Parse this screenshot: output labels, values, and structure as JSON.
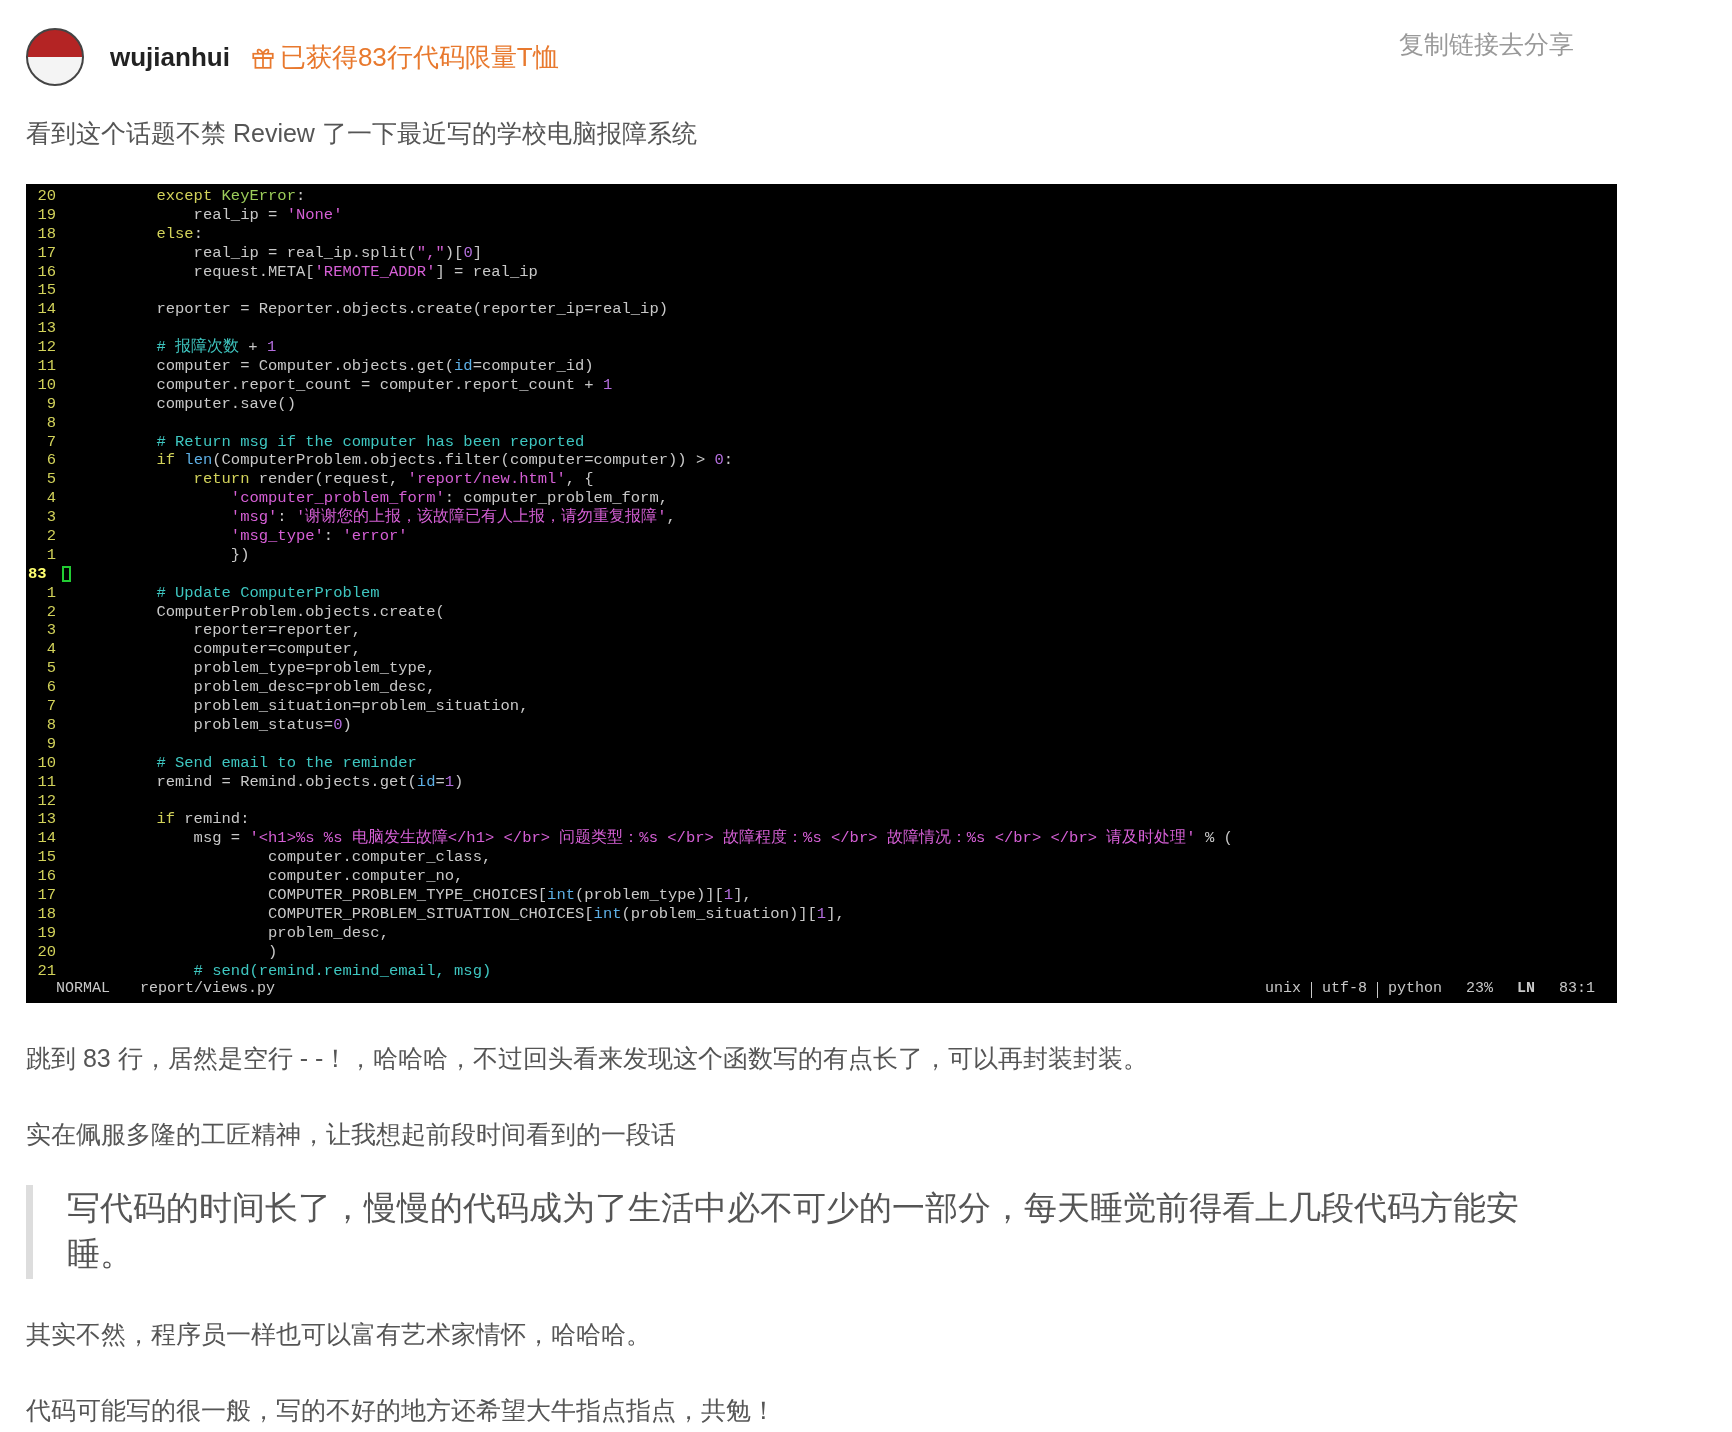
{
  "author": {
    "name": "wujianhui",
    "badge": "已获得83行代码限量T恤"
  },
  "share_link": "复制链接去分享",
  "intro": "看到这个话题不禁 Review 了一下最近写的学校电脑报障系统",
  "editor": {
    "lines": [
      {
        "number": "20",
        "current": false,
        "tokens": [
          {
            "kind": "kw",
            "text": "        except"
          },
          {
            "kind": "type",
            "text": " KeyError"
          },
          {
            "kind": "plain",
            "text": ":"
          }
        ]
      },
      {
        "number": "19",
        "current": false,
        "tokens": [
          {
            "kind": "plain",
            "text": "            real_ip = "
          },
          {
            "kind": "str",
            "text": "'None'"
          }
        ]
      },
      {
        "number": "18",
        "current": false,
        "tokens": [
          {
            "kind": "kw",
            "text": "        else"
          },
          {
            "kind": "plain",
            "text": ":"
          }
        ]
      },
      {
        "number": "17",
        "current": false,
        "tokens": [
          {
            "kind": "plain",
            "text": "            real_ip = real_ip.split("
          },
          {
            "kind": "str",
            "text": "\",\""
          },
          {
            "kind": "plain",
            "text": ")["
          },
          {
            "kind": "num",
            "text": "0"
          },
          {
            "kind": "plain",
            "text": "]"
          }
        ]
      },
      {
        "number": "16",
        "current": false,
        "tokens": [
          {
            "kind": "plain",
            "text": "            request.META["
          },
          {
            "kind": "str",
            "text": "'REMOTE_ADDR'"
          },
          {
            "kind": "plain",
            "text": "] = real_ip"
          }
        ]
      },
      {
        "number": "15",
        "current": false
      },
      {
        "number": "14",
        "current": false,
        "tokens": [
          {
            "kind": "plain",
            "text": "        reporter = Reporter.objects.create(reporter_ip=real_ip)"
          }
        ]
      },
      {
        "number": "13",
        "current": false
      },
      {
        "number": "12",
        "current": false,
        "tokens": [
          {
            "kind": "cmt",
            "text": "        # 报障次数"
          },
          {
            "kind": "plain",
            "text": " + "
          },
          {
            "kind": "num",
            "text": "1"
          }
        ]
      },
      {
        "number": "11",
        "current": false,
        "tokens": [
          {
            "kind": "plain",
            "text": "        computer = Computer.objects.get("
          },
          {
            "kind": "bi",
            "text": "id"
          },
          {
            "kind": "plain",
            "text": "=computer_id)"
          }
        ]
      },
      {
        "number": "10",
        "current": false,
        "tokens": [
          {
            "kind": "plain",
            "text": "        computer.report_count = computer.report_count + "
          },
          {
            "kind": "num",
            "text": "1"
          }
        ]
      },
      {
        "number": "9",
        "current": false,
        "tokens": [
          {
            "kind": "plain",
            "text": "        computer.save()"
          }
        ]
      },
      {
        "number": "8",
        "current": false
      },
      {
        "number": "7",
        "current": false,
        "tokens": [
          {
            "kind": "cmt",
            "text": "        # Return msg if the computer has been reported"
          }
        ]
      },
      {
        "number": "6",
        "current": false,
        "tokens": [
          {
            "kind": "kw",
            "text": "        if "
          },
          {
            "kind": "bi",
            "text": "len"
          },
          {
            "kind": "plain",
            "text": "(ComputerProblem.objects.filter(computer=computer)) > "
          },
          {
            "kind": "num",
            "text": "0"
          },
          {
            "kind": "plain",
            "text": ":"
          }
        ]
      },
      {
        "number": "5",
        "current": false,
        "tokens": [
          {
            "kind": "kw",
            "text": "            return"
          },
          {
            "kind": "plain",
            "text": " render(request, "
          },
          {
            "kind": "str",
            "text": "'report/new.html'"
          },
          {
            "kind": "plain",
            "text": ", {"
          }
        ]
      },
      {
        "number": "4",
        "current": false,
        "tokens": [
          {
            "kind": "str",
            "text": "                'computer_problem_form'"
          },
          {
            "kind": "plain",
            "text": ": computer_problem_form,"
          }
        ]
      },
      {
        "number": "3",
        "current": false,
        "tokens": [
          {
            "kind": "str",
            "text": "                'msg'"
          },
          {
            "kind": "plain",
            "text": ": "
          },
          {
            "kind": "str",
            "text": "'谢谢您的上报，该故障已有人上报，请勿重复报障'"
          },
          {
            "kind": "plain",
            "text": ","
          }
        ]
      },
      {
        "number": "2",
        "current": false,
        "tokens": [
          {
            "kind": "str",
            "text": "                'msg_type'"
          },
          {
            "kind": "plain",
            "text": ": "
          },
          {
            "kind": "str",
            "text": "'error'"
          }
        ]
      },
      {
        "number": "1",
        "current": false,
        "tokens": [
          {
            "kind": "plain",
            "text": "                })"
          }
        ]
      },
      {
        "number": "83",
        "current": true
      },
      {
        "number": "1",
        "current": false,
        "tokens": [
          {
            "kind": "cmt",
            "text": "        # Update ComputerProblem"
          }
        ]
      },
      {
        "number": "2",
        "current": false,
        "tokens": [
          {
            "kind": "plain",
            "text": "        ComputerProblem.objects.create("
          }
        ]
      },
      {
        "number": "3",
        "current": false,
        "tokens": [
          {
            "kind": "plain",
            "text": "            reporter=reporter,"
          }
        ]
      },
      {
        "number": "4",
        "current": false,
        "tokens": [
          {
            "kind": "plain",
            "text": "            computer=computer,"
          }
        ]
      },
      {
        "number": "5",
        "current": false,
        "tokens": [
          {
            "kind": "plain",
            "text": "            problem_type=problem_type,"
          }
        ]
      },
      {
        "number": "6",
        "current": false,
        "tokens": [
          {
            "kind": "plain",
            "text": "            problem_desc=problem_desc,"
          }
        ]
      },
      {
        "number": "7",
        "current": false,
        "tokens": [
          {
            "kind": "plain",
            "text": "            problem_situation=problem_situation,"
          }
        ]
      },
      {
        "number": "8",
        "current": false,
        "tokens": [
          {
            "kind": "plain",
            "text": "            problem_status="
          },
          {
            "kind": "num",
            "text": "0"
          },
          {
            "kind": "plain",
            "text": ")"
          }
        ]
      },
      {
        "number": "9",
        "current": false
      },
      {
        "number": "10",
        "current": false,
        "tokens": [
          {
            "kind": "cmt",
            "text": "        # Send email to the reminder"
          }
        ]
      },
      {
        "number": "11",
        "current": false,
        "tokens": [
          {
            "kind": "plain",
            "text": "        remind = Remind.objects.get("
          },
          {
            "kind": "bi",
            "text": "id"
          },
          {
            "kind": "plain",
            "text": "="
          },
          {
            "kind": "num",
            "text": "1"
          },
          {
            "kind": "plain",
            "text": ")"
          }
        ]
      },
      {
        "number": "12",
        "current": false
      },
      {
        "number": "13",
        "current": false,
        "tokens": [
          {
            "kind": "kw",
            "text": "        if"
          },
          {
            "kind": "plain",
            "text": " remind:"
          }
        ]
      },
      {
        "number": "14",
        "current": false,
        "tokens": [
          {
            "kind": "plain",
            "text": "            msg = "
          },
          {
            "kind": "str",
            "text": "'<h1>%s %s 电脑发生故障</h1> </br> 问题类型：%s </br> 故障程度：%s </br> 故障情况：%s </br> </br> 请及时处理'"
          },
          {
            "kind": "plain",
            "text": " % ("
          }
        ]
      },
      {
        "number": "15",
        "current": false,
        "tokens": [
          {
            "kind": "plain",
            "text": "                    computer.computer_class,"
          }
        ]
      },
      {
        "number": "16",
        "current": false,
        "tokens": [
          {
            "kind": "plain",
            "text": "                    computer.computer_no,"
          }
        ]
      },
      {
        "number": "17",
        "current": false,
        "tokens": [
          {
            "kind": "plain",
            "text": "                    COMPUTER_PROBLEM_TYPE_CHOICES["
          },
          {
            "kind": "bi",
            "text": "int"
          },
          {
            "kind": "plain",
            "text": "(problem_type)]["
          },
          {
            "kind": "num",
            "text": "1"
          },
          {
            "kind": "plain",
            "text": "],"
          }
        ]
      },
      {
        "number": "18",
        "current": false,
        "tokens": [
          {
            "kind": "plain",
            "text": "                    COMPUTER_PROBLEM_SITUATION_CHOICES["
          },
          {
            "kind": "bi",
            "text": "int"
          },
          {
            "kind": "plain",
            "text": "(problem_situation)]["
          },
          {
            "kind": "num",
            "text": "1"
          },
          {
            "kind": "plain",
            "text": "],"
          }
        ]
      },
      {
        "number": "19",
        "current": false,
        "tokens": [
          {
            "kind": "plain",
            "text": "                    problem_desc,"
          }
        ]
      },
      {
        "number": "20",
        "current": false,
        "tokens": [
          {
            "kind": "plain",
            "text": "                    )"
          }
        ]
      },
      {
        "number": "21",
        "current": false,
        "tokens": [
          {
            "kind": "cmt",
            "text": "            # send(remind.remind_email, msg)"
          }
        ]
      }
    ],
    "status_bar": {
      "mode": "NORMAL",
      "file": "report/views.py",
      "fileformat": "unix",
      "encoding": "utf-8",
      "filetype": "python",
      "percent": "23%",
      "position_label": "LN",
      "position": "83:1"
    }
  },
  "paragraphs": [
    "跳到 83 行，居然是空行 - -！，哈哈哈，不过回头看来发现这个函数写的有点长了，可以再封装封装。",
    "实在佩服多隆的工匠精神，让我想起前段时间看到的一段话"
  ],
  "quote": "写代码的时间长了，慢慢的代码成为了生活中必不可少的一部分，每天睡觉前得看上几段代码方能安睡。",
  "closing": [
    "其实不然，程序员一样也可以富有艺术家情怀，哈哈哈。",
    "代码可能写的很一般，写的不好的地方还希望大牛指点指点，共勉！"
  ]
}
